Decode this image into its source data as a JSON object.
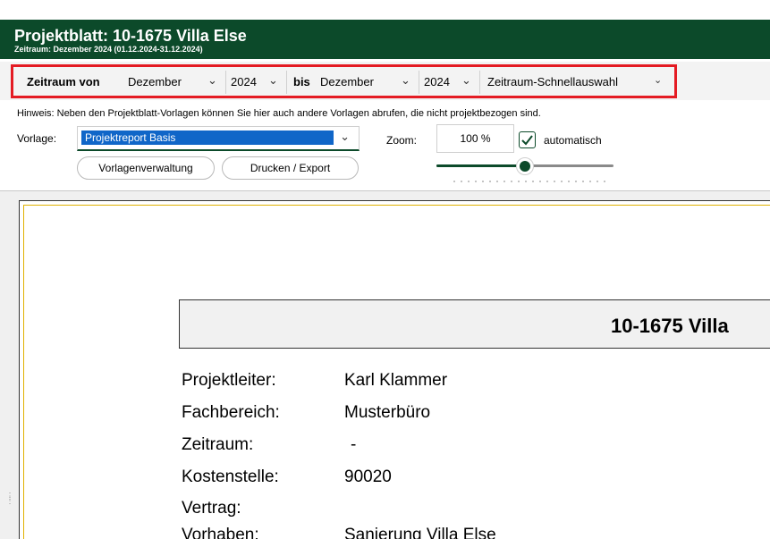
{
  "header": {
    "title": "Projektblatt: 10-1675 Villa Else",
    "subtitle": "Zeitraum: Dezember 2024 (01.12.2024-31.12.2024)"
  },
  "period": {
    "from_label": "Zeitraum von",
    "from_month": "Dezember",
    "from_year": "2024",
    "to_label": "bis",
    "to_month": "Dezember",
    "to_year": "2024",
    "quick_select": "Zeitraum-Schnellauswahl"
  },
  "hint": "Hinweis:  Neben den Projektblatt-Vorlagen können Sie hier auch andere Vorlagen abrufen, die nicht projektbezogen sind.",
  "template": {
    "label": "Vorlage:",
    "value": "Projektreport Basis"
  },
  "zoom": {
    "label": "Zoom:",
    "value": "100 %",
    "auto_label": "automatisch",
    "auto_checked": true,
    "slider_fraction": 0.5
  },
  "buttons": {
    "manage_templates": "Vorlagenverwaltung",
    "print_export": "Drucken / Export"
  },
  "report": {
    "title": "10-1675 Villa",
    "fields": [
      {
        "label": "Projektleiter:",
        "value": "Karl Klammer"
      },
      {
        "label": "Fachbereich:",
        "value": "Musterbüro"
      },
      {
        "label": "Zeitraum:",
        "value": "-"
      },
      {
        "label": "Kostenstelle:",
        "value": "90020"
      },
      {
        "label": "Vertrag:",
        "value": ""
      },
      {
        "label": "Vorhaben:",
        "value": "Sanierung Villa Else"
      }
    ]
  },
  "colors": {
    "header_bg": "#0c4a2a",
    "highlight_border": "#e41b23",
    "selection": "#1066c8",
    "paper_accent": "#e0b000"
  }
}
